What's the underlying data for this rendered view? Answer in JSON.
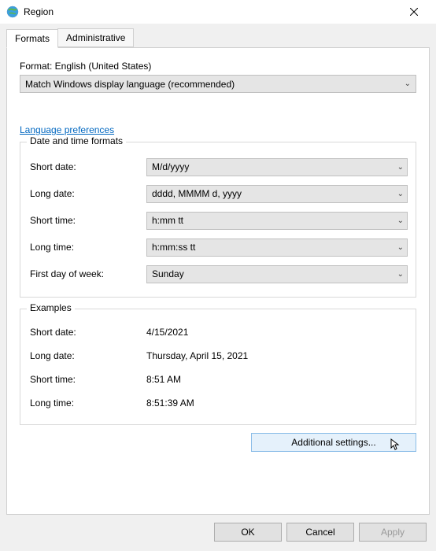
{
  "window": {
    "title": "Region"
  },
  "tabs": {
    "formats": "Formats",
    "administrative": "Administrative"
  },
  "format": {
    "label_prefix": "Format: ",
    "current": "English (United States)",
    "dropdown_value": "Match Windows display language (recommended)"
  },
  "links": {
    "language_preferences": "Language preferences"
  },
  "date_time_formats": {
    "legend": "Date and time formats",
    "rows": {
      "short_date": {
        "label": "Short date:",
        "value": "M/d/yyyy"
      },
      "long_date": {
        "label": "Long date:",
        "value": "dddd, MMMM d, yyyy"
      },
      "short_time": {
        "label": "Short time:",
        "value": "h:mm tt"
      },
      "long_time": {
        "label": "Long time:",
        "value": "h:mm:ss tt"
      },
      "first_day": {
        "label": "First day of week:",
        "value": "Sunday"
      }
    }
  },
  "examples": {
    "legend": "Examples",
    "rows": {
      "short_date": {
        "label": "Short date:",
        "value": "4/15/2021"
      },
      "long_date": {
        "label": "Long date:",
        "value": "Thursday, April 15, 2021"
      },
      "short_time": {
        "label": "Short time:",
        "value": "8:51 AM"
      },
      "long_time": {
        "label": "Long time:",
        "value": "8:51:39 AM"
      }
    }
  },
  "buttons": {
    "additional": "Additional settings...",
    "ok": "OK",
    "cancel": "Cancel",
    "apply": "Apply"
  }
}
